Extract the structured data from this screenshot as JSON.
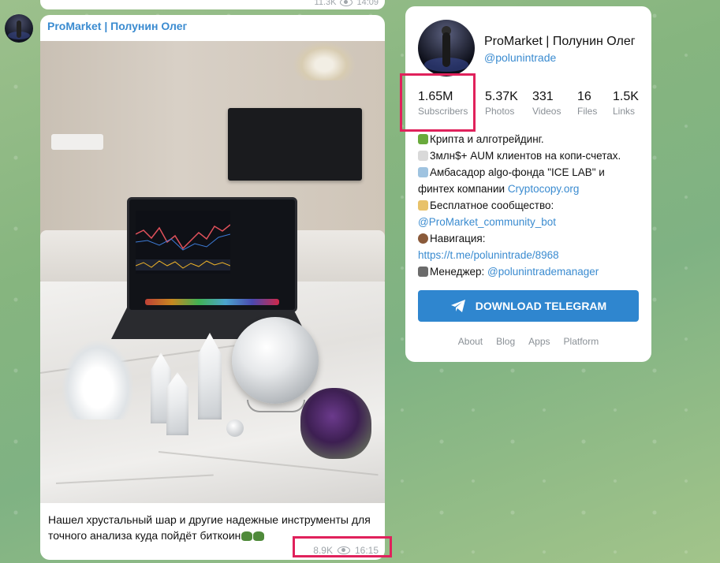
{
  "previous_post": {
    "views": "11.3K",
    "time": "14:09"
  },
  "post": {
    "author": "ProMarket | Полунин Олег",
    "caption_line1": "Нашел хрустальный шар и другие надежные инструменты для",
    "caption_line2": "точного анализа куда пойдёт биткоин",
    "views": "8.9K",
    "time": "16:15"
  },
  "channel": {
    "name": "ProMarket | Полунин Олег",
    "handle": "@polunintrade",
    "stats": [
      {
        "value": "1.65M",
        "label": "Subscribers"
      },
      {
        "value": "5.37K",
        "label": "Photos"
      },
      {
        "value": "331",
        "label": "Videos"
      },
      {
        "value": "16",
        "label": "Files"
      },
      {
        "value": "1.5K",
        "label": "Links"
      }
    ],
    "description": {
      "line1": "Крипта и алготрейдинг.",
      "line2": "3млн$+ AUM клиентов на копи-счетах.",
      "line3_prefix": "Амбасадор algo-фонда \"ICE LAB\" и",
      "line4_prefix": "финтех компании ",
      "line4_link": "Cryptocopy.org",
      "line5": "Бесплатное сообщество:",
      "line6_link": "@ProMarket_community_bot",
      "line7": "Навигация:",
      "line8_link": "https://t.me/polunintrade/8968",
      "line9_prefix": "Менеджер: ",
      "line9_link": "@polunintrademanager"
    },
    "download_label": "DOWNLOAD TELEGRAM",
    "footer_links": [
      "About",
      "Blog",
      "Apps",
      "Platform"
    ]
  },
  "colors": {
    "accent": "#3a8bd0",
    "button": "#2f86cf",
    "highlight": "#e0215b"
  }
}
